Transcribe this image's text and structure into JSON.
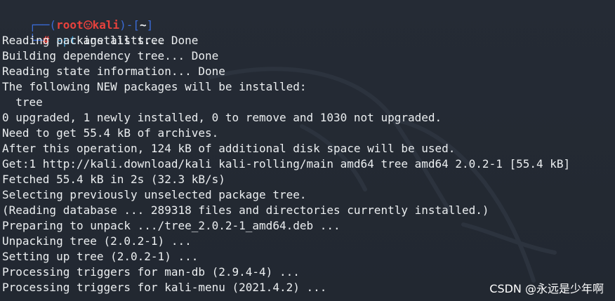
{
  "prompt": {
    "open": "┌──(",
    "user": "root",
    "host": "kali",
    "sep": ")-[",
    "path": "~",
    "close": "]",
    "second_prefix": "└─",
    "hash": "#",
    "command": "apt",
    "args": " install tree"
  },
  "output": [
    "Reading package lists... Done",
    "Building dependency tree... Done",
    "Reading state information... Done",
    "The following NEW packages will be installed:",
    "  tree",
    "0 upgraded, 1 newly installed, 0 to remove and 1030 not upgraded.",
    "Need to get 55.4 kB of archives.",
    "After this operation, 124 kB of additional disk space will be used.",
    "Get:1 http://kali.download/kali kali-rolling/main amd64 tree amd64 2.0.2-1 [55.4 kB]",
    "Fetched 55.4 kB in 2s (32.3 kB/s)",
    "Selecting previously unselected package tree.",
    "(Reading database ... 289318 files and directories currently installed.)",
    "Preparing to unpack .../tree_2.0.2-1_amd64.deb ...",
    "Unpacking tree (2.0.2-1) ...",
    "Setting up tree (2.0.2-1) ...",
    "Processing triggers for man-db (2.9.4-4) ...",
    "Processing triggers for kali-menu (2021.4.2) ..."
  ],
  "watermark": "CSDN @永远是少年啊",
  "colors": {
    "background": "#232933",
    "text": "#eceff1",
    "prompt_frame": "#3a6bd6",
    "prompt_user": "#e8413c",
    "command": "#3c9cd0"
  },
  "icons": {
    "user_host_separator": "skull-icon"
  }
}
